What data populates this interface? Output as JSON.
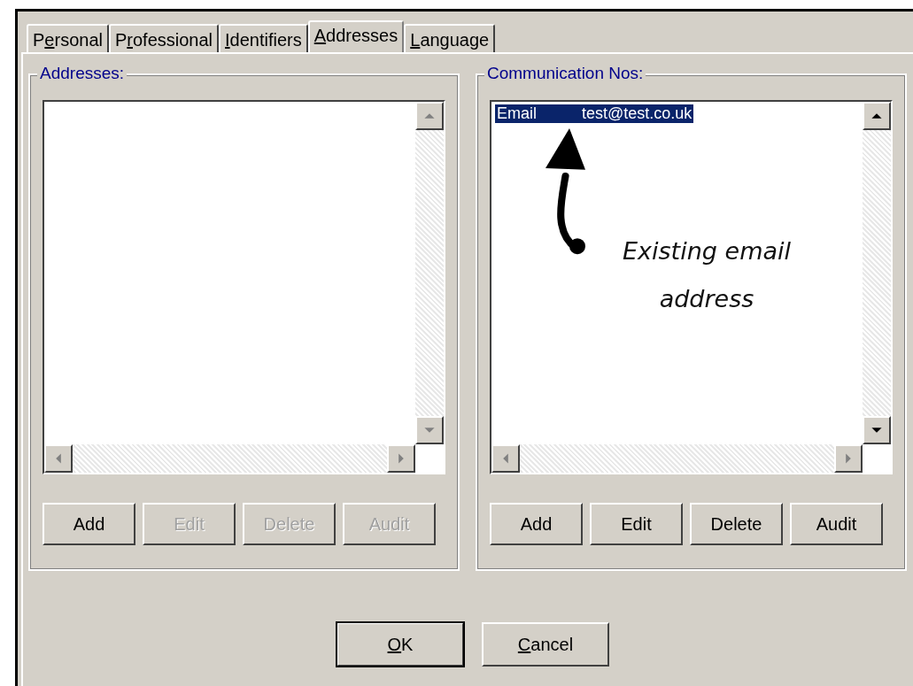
{
  "tabs": [
    {
      "label": {
        "pre": "P",
        "key": "e",
        "post": "rsonal"
      },
      "selected": false
    },
    {
      "label": {
        "pre": "P",
        "key": "r",
        "post": "ofessional"
      },
      "selected": false
    },
    {
      "label": {
        "key": "I",
        "post": "dentifiers"
      },
      "selected": false
    },
    {
      "label": {
        "key": "A",
        "post": "ddresses"
      },
      "selected": true
    },
    {
      "label": {
        "key": "L",
        "post": "anguage"
      },
      "selected": false
    }
  ],
  "groups": [
    {
      "title": "Addresses:",
      "buttons": [
        {
          "label": "Add",
          "disabled": false
        },
        {
          "label": "Edit",
          "disabled": true
        },
        {
          "label": "Delete",
          "disabled": true
        },
        {
          "label": "Audit",
          "disabled": true
        }
      ]
    },
    {
      "title": "Communication Nos:",
      "rows": [
        {
          "type": "Email",
          "value": "test@test.co.uk",
          "selected": true
        }
      ],
      "annotation": "Existing email address",
      "buttons": [
        {
          "label": "Add",
          "disabled": false
        },
        {
          "label": "Edit",
          "disabled": false
        },
        {
          "label": "Delete",
          "disabled": false
        },
        {
          "label": "Audit",
          "disabled": false
        }
      ]
    }
  ],
  "dialog_buttons": [
    {
      "label": {
        "key": "O",
        "post": "K"
      },
      "default": true
    },
    {
      "label": {
        "key": "C",
        "post": "ancel"
      },
      "default": false
    }
  ]
}
